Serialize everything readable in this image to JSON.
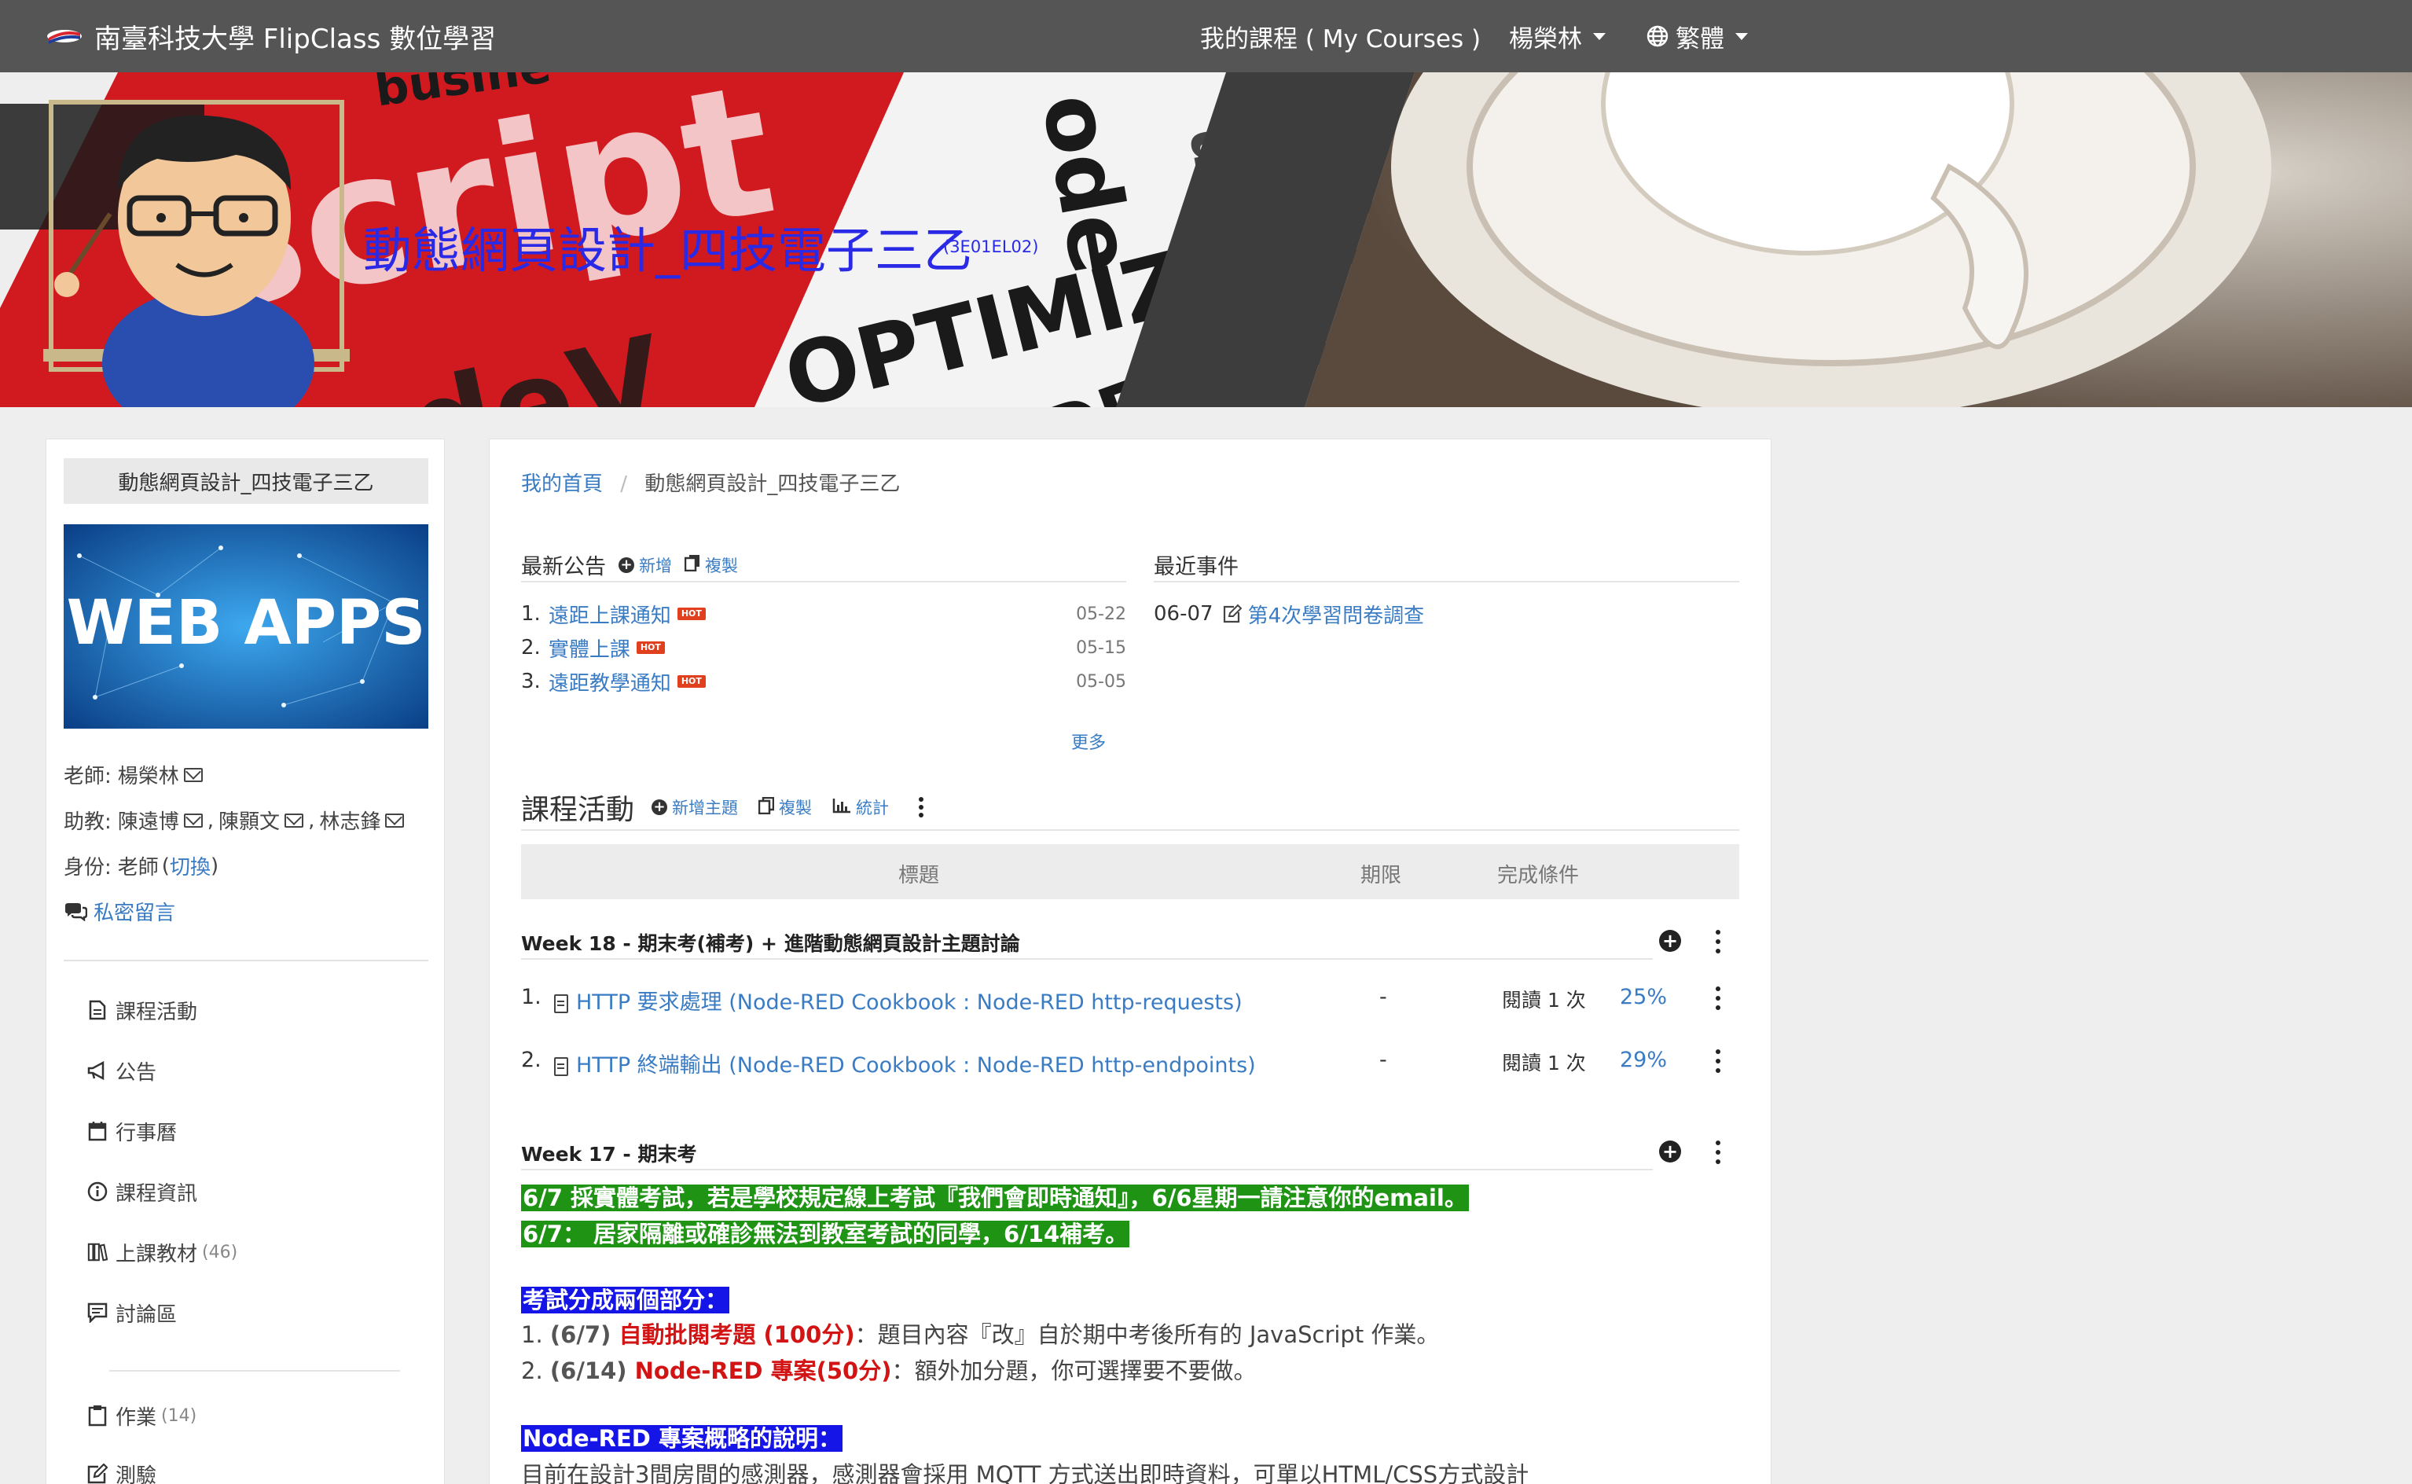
{
  "topnav": {
    "brand": "南臺科技大學 FlipClass 數位學習",
    "my_courses": "我的課程 ( My Courses )",
    "user": "楊榮林",
    "language": "繁體"
  },
  "banner": {
    "course_title": "動態網頁設計_四技電子三乙",
    "course_code": "(3E01EL02)"
  },
  "sidebar": {
    "title": "動態網頁設計_四技電子三乙",
    "image_text": "WEB APPS",
    "teacher_label": "老師:",
    "teacher_name": "楊榮林",
    "ta_label": "助教:",
    "ta_names": [
      "陳遠博",
      "陳顥文",
      "林志鋒"
    ],
    "identity_label": "身份:",
    "identity_value": "老師",
    "identity_switch": "切換",
    "private_msg": "私密留言",
    "menu": [
      {
        "label": "課程活動",
        "icon": "file-icon",
        "count": ""
      },
      {
        "label": "公告",
        "icon": "megaphone-icon",
        "count": ""
      },
      {
        "label": "行事曆",
        "icon": "calendar-icon",
        "count": ""
      },
      {
        "label": "課程資訊",
        "icon": "info-icon",
        "count": ""
      },
      {
        "label": "上課教材",
        "icon": "books-icon",
        "count": "(46)"
      },
      {
        "label": "討論區",
        "icon": "comment-icon",
        "count": ""
      }
    ],
    "menu2": [
      {
        "label": "作業",
        "icon": "clipboard-icon",
        "count": "(14)"
      },
      {
        "label": "測驗",
        "icon": "edit-icon",
        "count": ""
      }
    ]
  },
  "breadcrumb": {
    "home": "我的首頁",
    "current": "動態網頁設計_四技電子三乙"
  },
  "announcements": {
    "title": "最新公告",
    "add": "新增",
    "copy": "複製",
    "more": "更多",
    "items": [
      {
        "num": "1.",
        "title": "遠距上課通知",
        "date": "05-22",
        "badge": "HOT"
      },
      {
        "num": "2.",
        "title": "實體上課",
        "date": "05-15",
        "badge": "HOT"
      },
      {
        "num": "3.",
        "title": "遠距教學通知",
        "date": "05-05",
        "badge": "HOT"
      }
    ]
  },
  "events": {
    "title": "最近事件",
    "items": [
      {
        "date": "06-07",
        "title": "第4次學習問卷調查"
      }
    ]
  },
  "activities": {
    "title": "課程活動",
    "add_topic": "新增主題",
    "copy": "複製",
    "stats": "統計",
    "col_title": "標題",
    "col_deadline": "期限",
    "col_condition": "完成條件"
  },
  "weeks": [
    {
      "title": "Week 18 - 期末考(補考) + 進階動態網頁設計主題討論",
      "items": [
        {
          "num": "1.",
          "title": "HTTP 要求處理 (Node-RED Cookbook : Node-RED http-requests)",
          "deadline": "-",
          "condition": "閱讀 1 次",
          "percent": "25%"
        },
        {
          "num": "2.",
          "title": "HTTP 終端輸出 (Node-RED Cookbook : Node-RED http-endpoints)",
          "deadline": "-",
          "condition": "閱讀 1 次",
          "percent": "29%"
        }
      ]
    },
    {
      "title": "Week 17 - 期末考",
      "content": {
        "green1": "6/7 採實體考試，若是學校規定線上考試『我們會即時通知』，6/6星期一請注意你的email。",
        "green2": "6/7： 居家隔離或確診無法到教室考試的同學，6/14補考。",
        "blue1": "考試分成兩個部分：",
        "line1_num": "1. ",
        "line1_date": "(6/7)",
        "line1_red": " 自動批閱考題 (100分)",
        "line1_rest": "：題目內容『改』自於期中考後所有的 JavaScript 作業。",
        "line2_num": "2. ",
        "line2_date": "(6/14)",
        "line2_red": " Node-RED 專案(50分)",
        "line2_rest": "：額外加分題，你可選擇要不要做。",
        "blue2": "Node-RED 專案概略的說明：",
        "line3": "目前在設計3間房間的感測器，感測器會採用 MQTT 方式送出即時資料，可單以HTML/CSS方式設計"
      }
    }
  ],
  "colors": {
    "nav_bg": "#555555",
    "link": "#3a7cc4",
    "highlight_green": "#1f9414",
    "highlight_blue": "#1515e8",
    "hot_badge": "#e0401e",
    "red_text": "#d21414"
  }
}
